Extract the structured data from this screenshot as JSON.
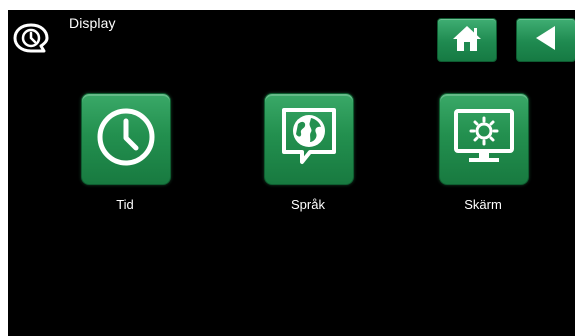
{
  "header": {
    "title": "Display",
    "title_icon": "speech-bubble-clock-icon",
    "home_icon": "home-icon",
    "back_icon": "back-arrow-icon"
  },
  "menu": {
    "items": [
      {
        "label": "Tid",
        "icon": "clock-icon"
      },
      {
        "label": "Språk",
        "icon": "globe-icon"
      },
      {
        "label": "Skärm",
        "icon": "monitor-brightness-icon"
      }
    ]
  },
  "colors": {
    "background": "#000000",
    "button_green": "#23904f",
    "text": "#ffffff"
  }
}
